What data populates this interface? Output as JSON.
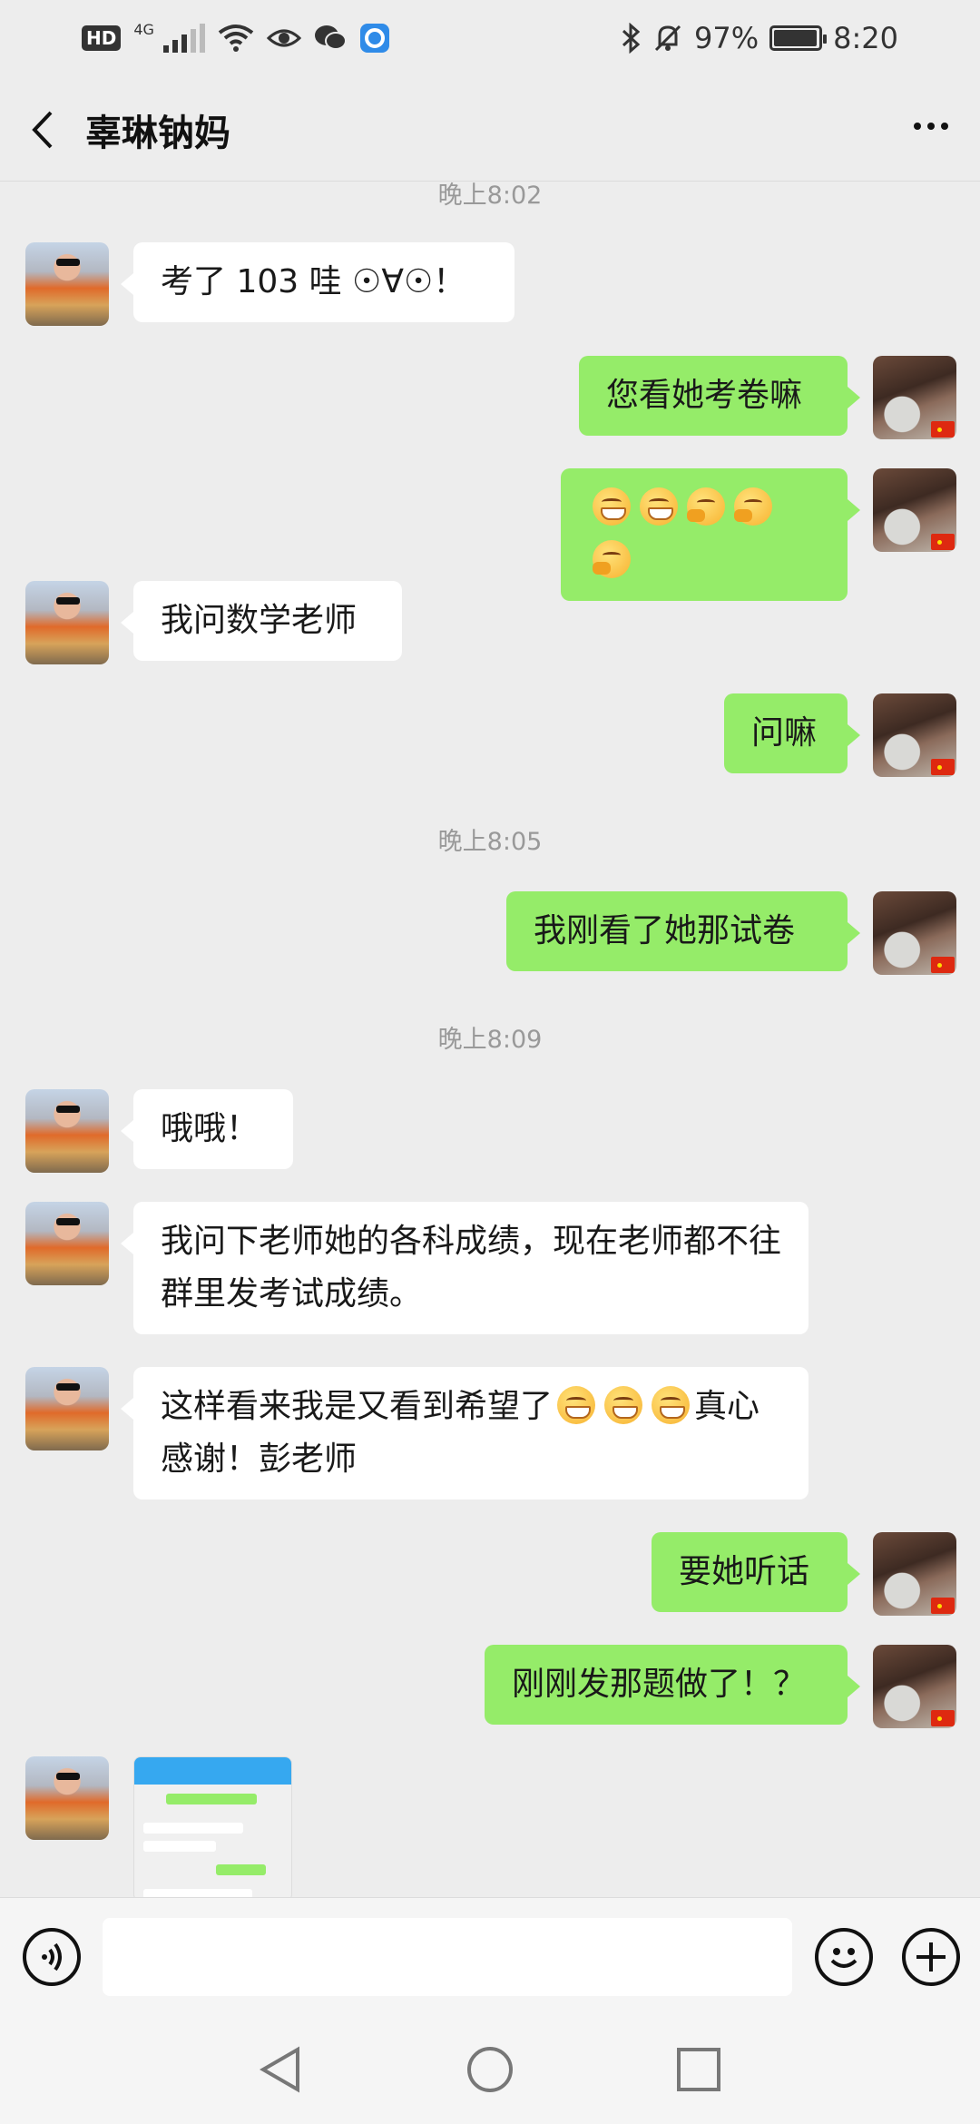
{
  "status_bar": {
    "hd_label": "HD",
    "network": "4G",
    "battery": "97%",
    "battery_level": 0.97,
    "time": "8:20"
  },
  "header": {
    "title": "辜琳钠妈"
  },
  "timestamps": [
    "晚上8:02",
    "晚上8:05",
    "晚上8:09"
  ],
  "messages": [
    {
      "side": "left",
      "text": "考了 103 哇 ☉∀☉！"
    },
    {
      "side": "right",
      "text": "您看她考卷嘛"
    },
    {
      "side": "right",
      "text": "",
      "emoji": [
        "grin",
        "grin",
        "think",
        "think",
        "think"
      ]
    },
    {
      "side": "left",
      "text": "我问数学老师"
    },
    {
      "side": "right",
      "text": "问嘛"
    },
    {
      "side": "right",
      "text": "我刚看了她那试卷"
    },
    {
      "side": "left",
      "text": "哦哦！"
    },
    {
      "side": "left",
      "text": "我问下老师她的各科成绩，现在老师都不往群里发考试成绩。"
    },
    {
      "side": "left",
      "text_before": "这样看来我是又看到希望了",
      "text_after": "真心感谢！彭老师"
    },
    {
      "side": "right",
      "text": "要她听话"
    },
    {
      "side": "right",
      "text": "刚刚发那题做了！？"
    },
    {
      "side": "left",
      "type": "image"
    }
  ],
  "input_bar": {
    "placeholder": ""
  },
  "icons": {
    "back": "chevron-left-icon",
    "more": "more-dots-icon",
    "voice": "voice-icon",
    "emoji": "smiley-icon",
    "plus": "plus-icon"
  },
  "colors": {
    "background": "#ededed",
    "sent_bubble": "#95ec69",
    "received_bubble": "#ffffff",
    "timestamp": "#999999"
  }
}
